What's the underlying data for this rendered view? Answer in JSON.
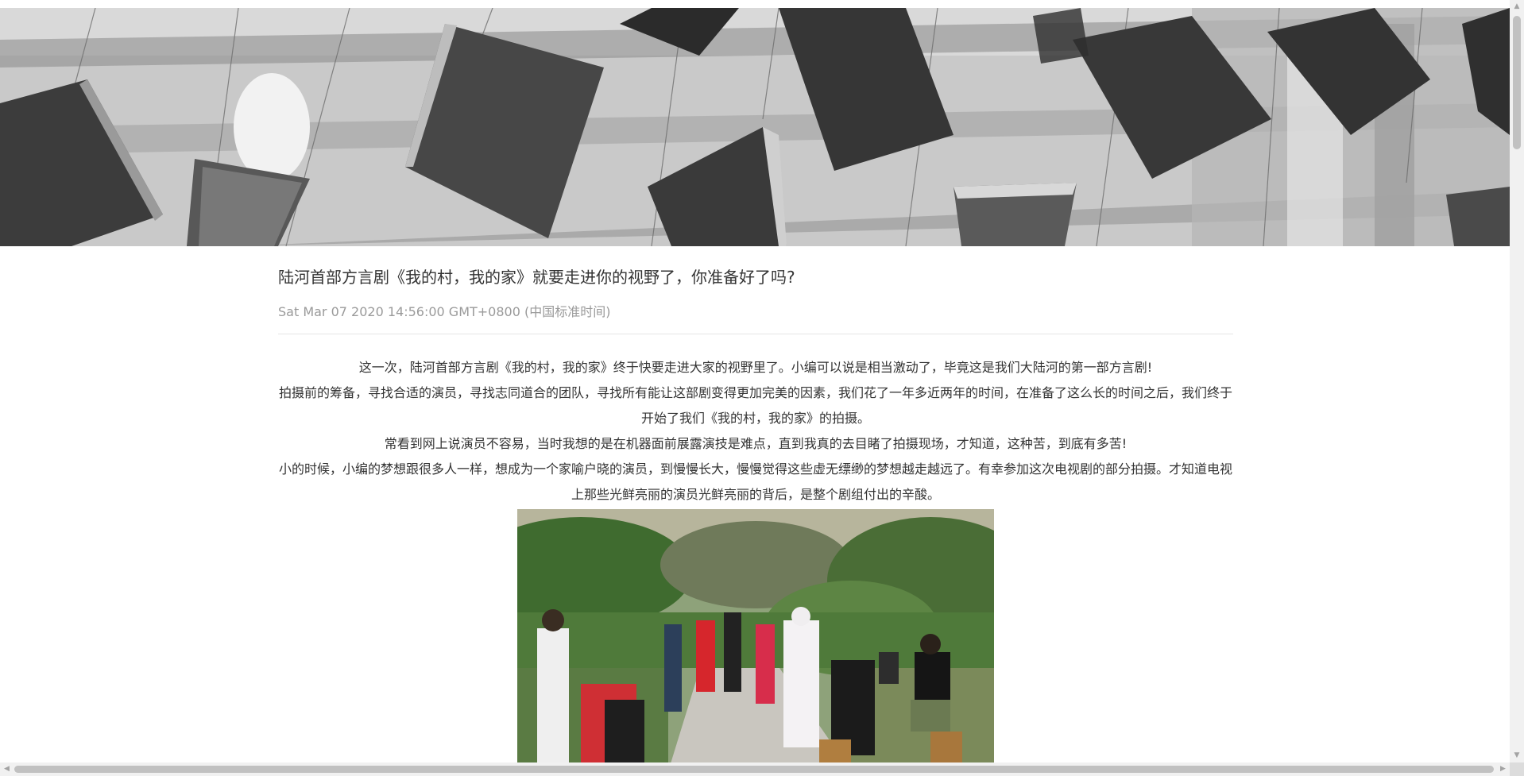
{
  "article": {
    "title": "陆河首部方言剧《我的村，我的家》就要走进你的视野了，你准备好了吗?",
    "date": "Sat Mar 07 2020 14:56:00 GMT+0800 (中国标准时间)",
    "paragraphs": [
      "这一次，陆河首部方言剧《我的村，我的家》终于快要走进大家的视野里了。小编可以说是相当激动了，毕竟这是我们大陆河的第一部方言剧!",
      "拍摄前的筹备，寻找合适的演员，寻找志同道合的团队，寻找所有能让这部剧变得更加完美的因素，我们花了一年多近两年的时间，在准备了这么长的时间之后，我们终于开始了我们《我的村，我的家》的拍摄。",
      "常看到网上说演员不容易，当时我想的是在机器面前展露演技是难点，直到我真的去目睹了拍摄现场，才知道，这种苦，到底有多苦!",
      "小的时候，小编的梦想跟很多人一样，想成为一个家喻户晓的演员，到慢慢长大，慢慢觉得这些虚无缥缈的梦想越走越远了。有幸参加这次电视剧的部分拍摄。才知道电视上那些光鲜亮丽的演员光鲜亮丽的背后，是整个剧组付出的辛酸。"
    ]
  },
  "icons": {
    "scroll_up": "▲",
    "scroll_down": "▼",
    "scroll_left": "◀",
    "scroll_right": "▶"
  }
}
